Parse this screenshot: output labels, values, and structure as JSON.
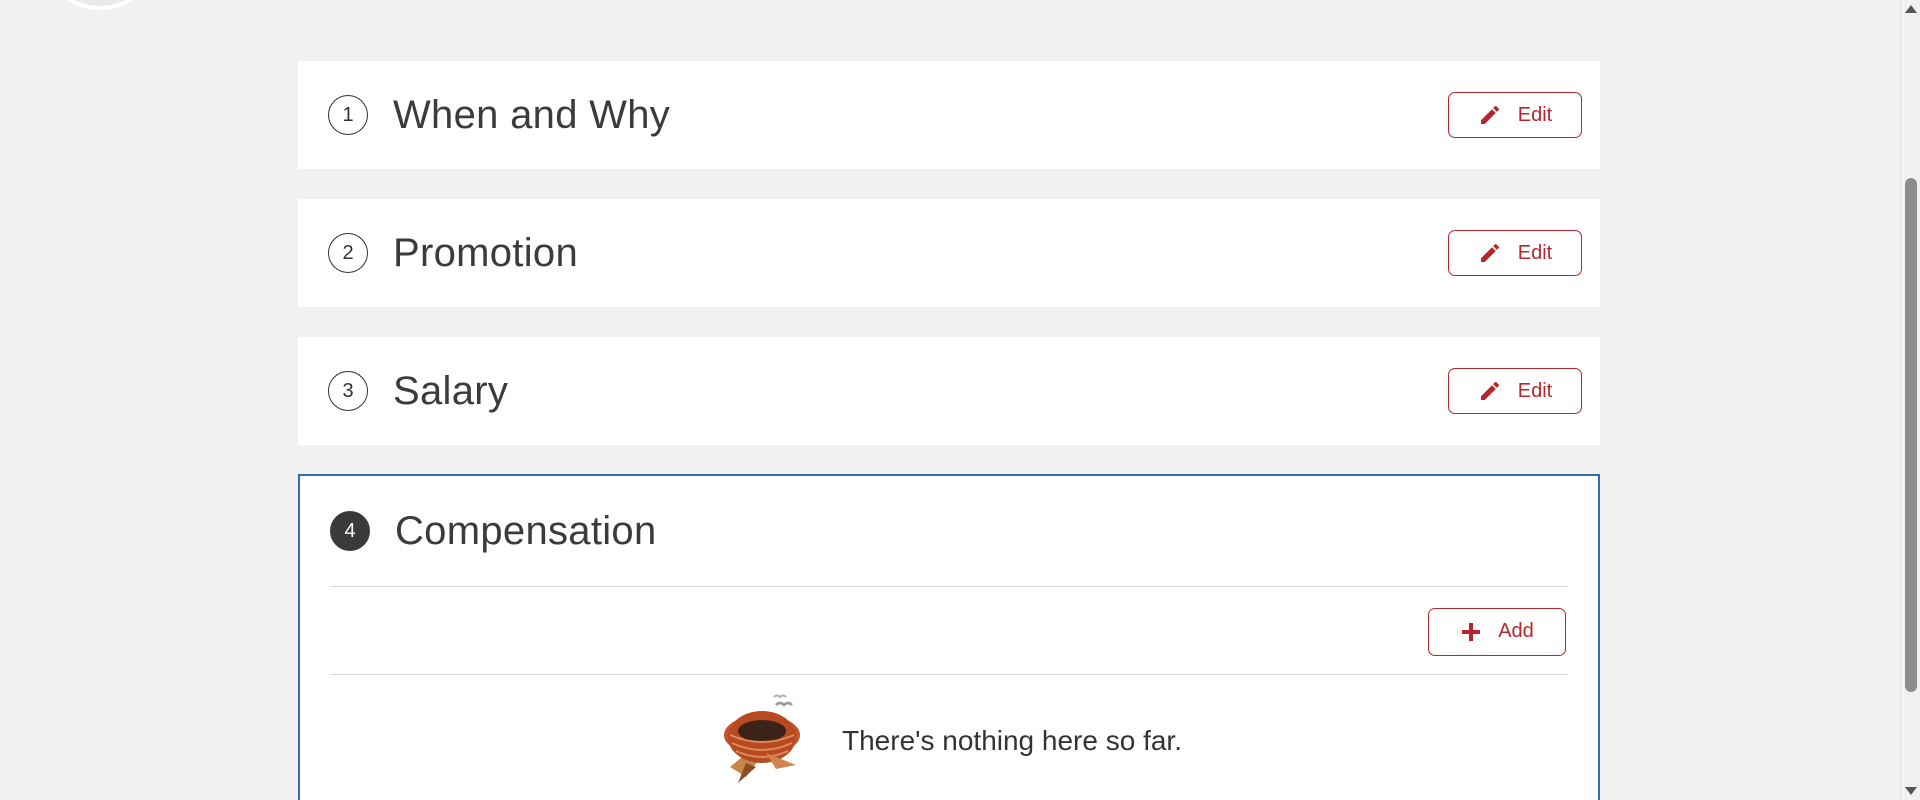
{
  "sections": [
    {
      "number": "1",
      "title": "When and Why",
      "button_label": "Edit",
      "button_icon": "pencil-icon"
    },
    {
      "number": "2",
      "title": "Promotion",
      "button_label": "Edit",
      "button_icon": "pencil-icon"
    },
    {
      "number": "3",
      "title": "Salary",
      "button_label": "Edit",
      "button_icon": "pencil-icon"
    }
  ],
  "active_section": {
    "number": "4",
    "title": "Compensation",
    "add_label": "Add",
    "add_icon": "plus-icon",
    "empty_message": "There's nothing here so far.",
    "empty_icon": "empty-nest-icon"
  },
  "colors": {
    "accent": "#b5262d",
    "active_border": "#2f6db5",
    "background": "#f1f1f1"
  }
}
